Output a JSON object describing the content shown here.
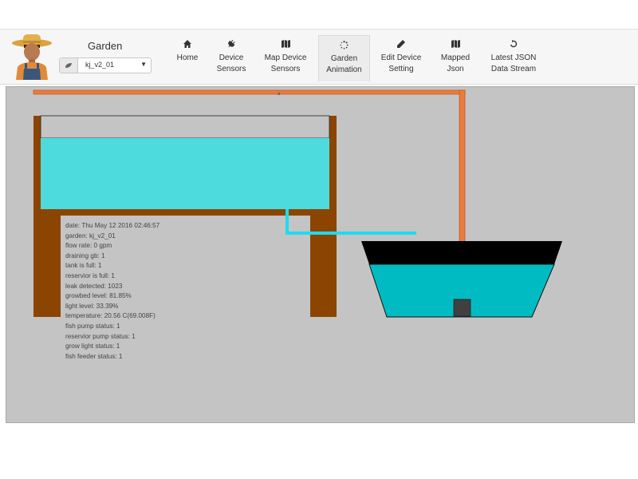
{
  "header": {
    "garden_label": "Garden",
    "device_select": {
      "selected": "kj_v2_01",
      "leaf_icon": "leaf-icon",
      "caret_icon": "caret-down-icon"
    }
  },
  "nav": [
    {
      "id": "home",
      "line1": "",
      "line2": "Home",
      "icon": "home-icon",
      "active": false
    },
    {
      "id": "device-sensors",
      "line1": "Device",
      "line2": "Sensors",
      "icon": "plug-icon",
      "active": false
    },
    {
      "id": "map-device-sensors",
      "line1": "Map Device",
      "line2": "Sensors",
      "icon": "map-icon",
      "active": false
    },
    {
      "id": "garden-animation",
      "line1": "Garden",
      "line2": "Animation",
      "icon": "spinner-icon",
      "active": true
    },
    {
      "id": "edit-device-setting",
      "line1": "Edit Device",
      "line2": "Setting",
      "icon": "pencil-icon",
      "active": false
    },
    {
      "id": "mapped-json",
      "line1": "Mapped",
      "line2": "Json",
      "icon": "map-icon",
      "active": false
    },
    {
      "id": "latest-json-data-stream",
      "line1": "Latest JSON",
      "line2": "Data Stream",
      "icon": "refresh-icon",
      "active": false
    }
  ],
  "status": [
    "date: Thu May 12 2016 02:46:57",
    "garden: kj_v2_01",
    "flow rate: 0 gpm",
    "draining gb: 1",
    "tank is full: 1",
    "reservior is full: 1",
    "leak detected: 1023",
    "growbed level: 81.85%",
    "light level: 33.39%",
    "temperature: 20.56 C(69.008F)",
    "fish pump status: 1",
    "reservior pump status: 1",
    "grow light status: 1",
    "fish feeder status: 1"
  ],
  "colors": {
    "water_growbed": "#4ddbdd",
    "water_tank": "#00bcc2",
    "wood": "#8b4500",
    "pipe": "#e87c3e",
    "drain_pipe": "#1cdcf0",
    "canvas_bg": "#c4c4c4",
    "tank_top": "#000000",
    "pump": "#404040"
  },
  "levels": {
    "growbed_level_pct": 81.85
  }
}
